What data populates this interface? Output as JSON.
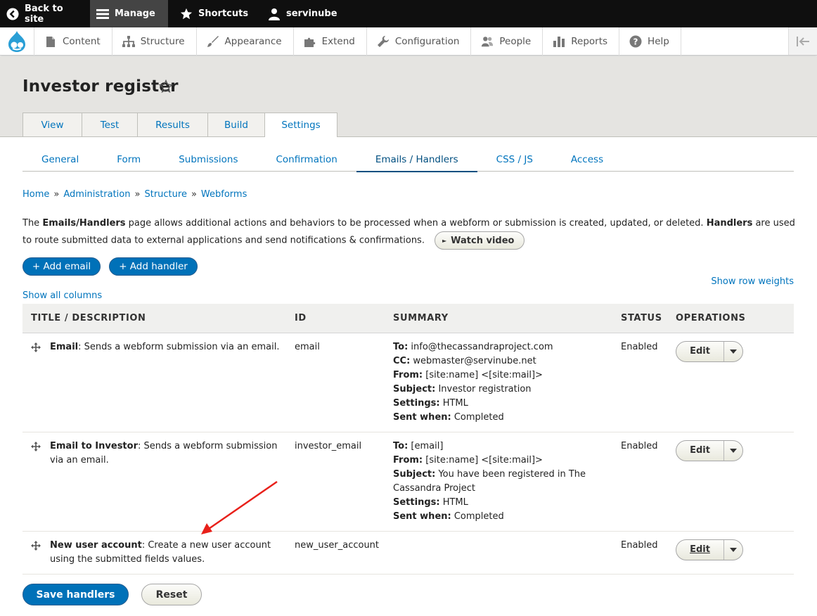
{
  "toolbar": {
    "back_label": "Back to site",
    "manage_label": "Manage",
    "shortcuts_label": "Shortcuts",
    "user_label": "servinube"
  },
  "tray": {
    "items": [
      {
        "label": "Content",
        "icon": "page-icon"
      },
      {
        "label": "Structure",
        "icon": "sitemap-icon"
      },
      {
        "label": "Appearance",
        "icon": "paintbrush-icon"
      },
      {
        "label": "Extend",
        "icon": "puzzle-icon"
      },
      {
        "label": "Configuration",
        "icon": "wrench-icon"
      },
      {
        "label": "People",
        "icon": "people-icon"
      },
      {
        "label": "Reports",
        "icon": "bar-chart-icon"
      },
      {
        "label": "Help",
        "icon": "help-icon"
      }
    ]
  },
  "page": {
    "title": "Investor register"
  },
  "primary_tabs": [
    {
      "label": "View"
    },
    {
      "label": "Test"
    },
    {
      "label": "Results"
    },
    {
      "label": "Build"
    },
    {
      "label": "Settings",
      "active": true
    }
  ],
  "secondary_tabs": [
    {
      "label": "General"
    },
    {
      "label": "Form"
    },
    {
      "label": "Submissions"
    },
    {
      "label": "Confirmation"
    },
    {
      "label": "Emails / Handlers",
      "active": true
    },
    {
      "label": "CSS / JS"
    },
    {
      "label": "Access"
    }
  ],
  "breadcrumb": [
    "Home",
    "Administration",
    "Structure",
    "Webforms"
  ],
  "description": {
    "part1": "The ",
    "bold1": "Emails/Handlers",
    "part2": " page allows additional actions and behaviors to be processed when a webform or submission is created, updated, or deleted. ",
    "bold2": "Handlers",
    "part3": " are used to route submitted data to external applications and send notifications & confirmations.",
    "watch_video": "Watch video"
  },
  "actions": {
    "add_email": "+ Add email",
    "add_handler": "+ Add handler",
    "show_all_columns": "Show all columns",
    "show_row_weights": "Show row weights"
  },
  "table": {
    "headers": [
      "TITLE / DESCRIPTION",
      "ID",
      "SUMMARY",
      "STATUS",
      "OPERATIONS"
    ],
    "rows": [
      {
        "title": "Email",
        "description": ": Sends a webform submission via an email.",
        "id": "email",
        "summary": [
          {
            "k": "To:",
            "v": " info@thecassandraproject.com"
          },
          {
            "k": "CC:",
            "v": " webmaster@servinube.net"
          },
          {
            "k": "From:",
            "v": " [site:name] <[site:mail]>"
          },
          {
            "k": "Subject:",
            "v": " Investor registration"
          },
          {
            "k": "Settings:",
            "v": " HTML"
          },
          {
            "k": "Sent when:",
            "v": " Completed"
          }
        ],
        "status": "Enabled",
        "op": "Edit"
      },
      {
        "title": "Email to Investor",
        "description": ": Sends a webform submission via an email.",
        "id": "investor_email",
        "summary": [
          {
            "k": "To:",
            "v": " [email]"
          },
          {
            "k": "From:",
            "v": " [site:name] <[site:mail]>"
          },
          {
            "k": "Subject:",
            "v": " You have been registered in The Cassandra Project"
          },
          {
            "k": "Settings:",
            "v": " HTML"
          },
          {
            "k": "Sent when:",
            "v": " Completed"
          }
        ],
        "status": "Enabled",
        "op": "Edit"
      },
      {
        "title": "New user account",
        "description": ": Create a new user account using the submitted fields values.",
        "id": "new_user_account",
        "summary": [],
        "status": "Enabled",
        "op": "Edit"
      }
    ]
  },
  "form_actions": {
    "save": "Save handlers",
    "reset": "Reset"
  },
  "colors": {
    "accent": "#0071b8",
    "link": "#0074bd",
    "toolbar_bg": "#0f0f0f",
    "header_bg": "#e5e4e1",
    "annotation": "#e8201a"
  }
}
